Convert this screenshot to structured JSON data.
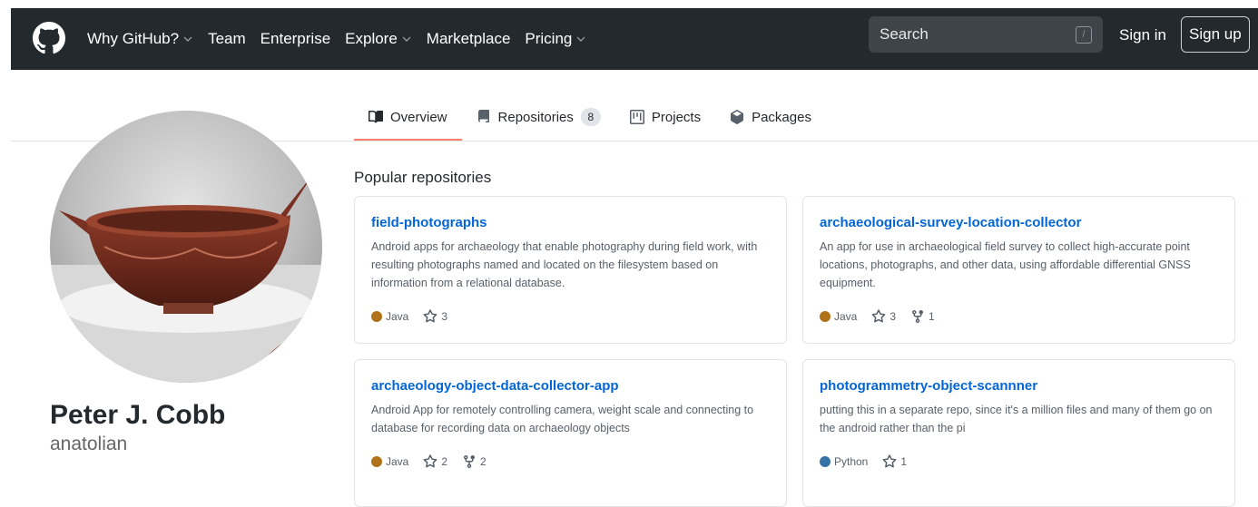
{
  "header": {
    "nav": [
      {
        "label": "Why GitHub?",
        "dropdown": true
      },
      {
        "label": "Team",
        "dropdown": false
      },
      {
        "label": "Enterprise",
        "dropdown": false
      },
      {
        "label": "Explore",
        "dropdown": true
      },
      {
        "label": "Marketplace",
        "dropdown": false
      },
      {
        "label": "Pricing",
        "dropdown": true
      }
    ],
    "search_placeholder": "Search",
    "search_shortcut": "/",
    "signin_label": "Sign in",
    "signup_label": "Sign up"
  },
  "tabs": [
    {
      "label": "Overview",
      "icon": "book-icon",
      "active": true
    },
    {
      "label": "Repositories",
      "icon": "repo-icon",
      "count": "8"
    },
    {
      "label": "Projects",
      "icon": "project-icon"
    },
    {
      "label": "Packages",
      "icon": "package-icon"
    }
  ],
  "profile": {
    "fullname": "Peter J. Cobb",
    "username": "anatolian"
  },
  "popular": {
    "title": "Popular repositories",
    "repos": [
      {
        "name": "field-photographs",
        "description": "Android apps for archaeology that enable photography during field work, with resulting photographs named and located on the filesystem based on information from a relational database.",
        "language": "Java",
        "language_color": "#b07219",
        "stars": "3",
        "forks": ""
      },
      {
        "name": "archaeological-survey-location-collector",
        "description": "An app for use in archaeological field survey to collect high-accurate point locations, photographs, and other data, using affordable differential GNSS equipment.",
        "language": "Java",
        "language_color": "#b07219",
        "stars": "3",
        "forks": "1"
      },
      {
        "name": "archaeology-object-data-collector-app",
        "description": "Android App for remotely controlling camera, weight scale and connecting to database for recording data on archaeology objects",
        "language": "Java",
        "language_color": "#b07219",
        "stars": "2",
        "forks": "2"
      },
      {
        "name": "photogrammetry-object-scannner",
        "description": "putting this in a separate repo, since it's a million files and many of them go on the android rather than the pi",
        "language": "Python",
        "language_color": "#3572A5",
        "stars": "1",
        "forks": ""
      }
    ]
  }
}
